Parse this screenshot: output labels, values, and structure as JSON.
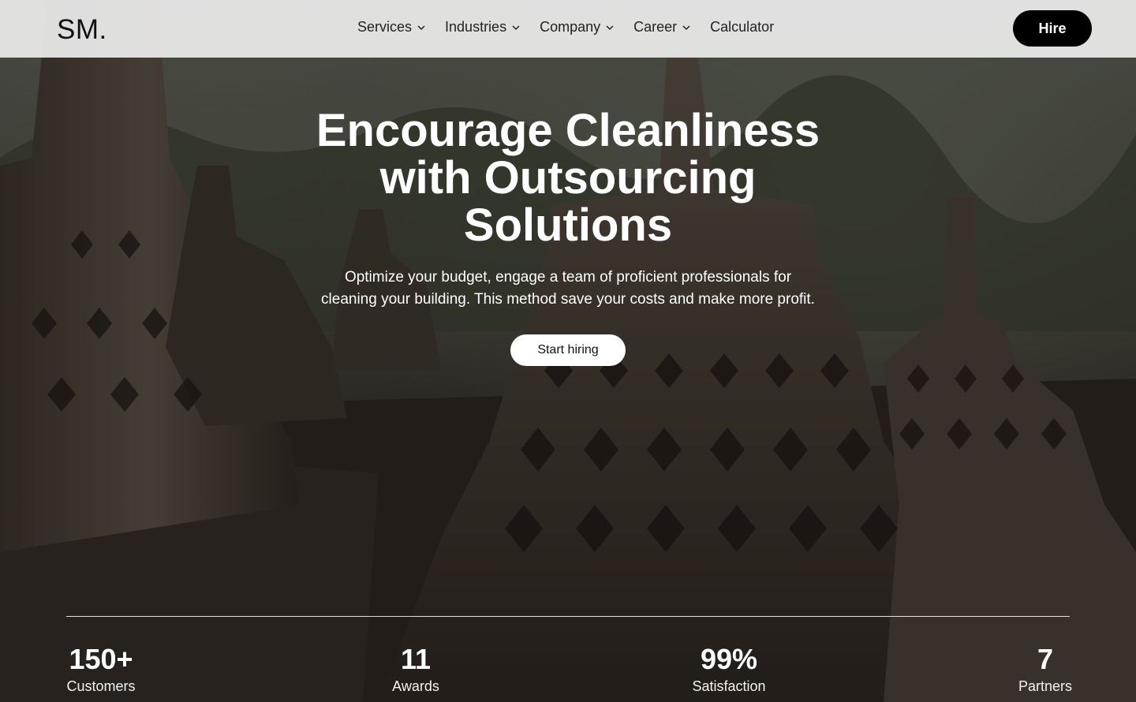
{
  "header": {
    "logo": "SM.",
    "nav": [
      {
        "label": "Services",
        "has_dropdown": true
      },
      {
        "label": "Industries",
        "has_dropdown": true
      },
      {
        "label": "Company",
        "has_dropdown": true
      },
      {
        "label": "Career",
        "has_dropdown": true
      },
      {
        "label": "Calculator",
        "has_dropdown": false
      }
    ],
    "hire_label": "Hire"
  },
  "hero": {
    "title_lines": [
      "Encourage Cleanliness",
      "with Outsourcing",
      "Solutions"
    ],
    "subtitle_lines": [
      "Optimize your budget, engage a team of proficient professionals for",
      "cleaning your building. This method save your costs and make more profit."
    ],
    "cta_label": "Start hiring"
  },
  "stats": [
    {
      "value": "150+",
      "label": "Customers"
    },
    {
      "value": "11",
      "label": "Awards"
    },
    {
      "value": "99%",
      "label": "Satisfaction"
    },
    {
      "value": "7",
      "label": "Partners"
    }
  ],
  "colors": {
    "header_bg": "#ececec",
    "hire_bg": "#000000",
    "text_light": "#ffffff"
  },
  "icons": {
    "nav_dropdown": "chevron-down-icon"
  }
}
